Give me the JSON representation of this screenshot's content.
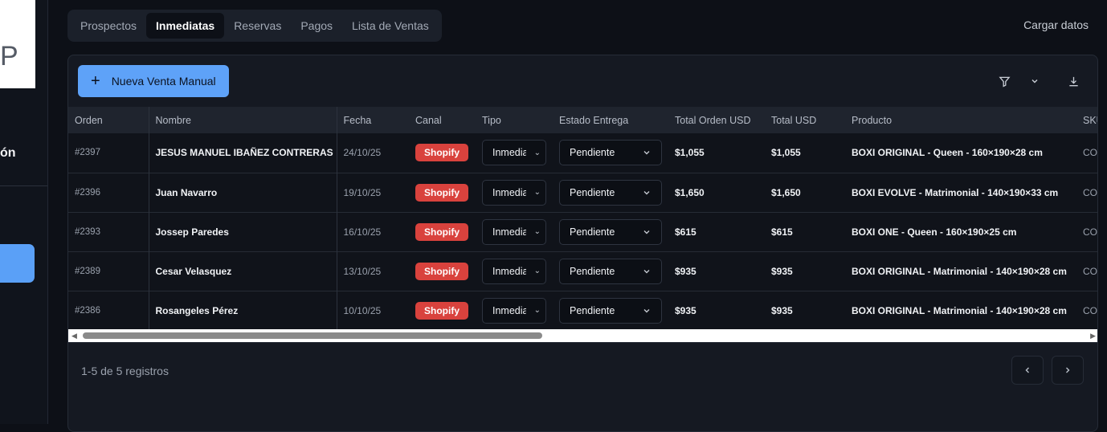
{
  "sidebar": {
    "logo_letter": "P",
    "section_label": "ón"
  },
  "tabs": [
    {
      "label": "Prospectos",
      "active": false
    },
    {
      "label": "Inmediatas",
      "active": true
    },
    {
      "label": "Reservas",
      "active": false
    },
    {
      "label": "Pagos",
      "active": false
    },
    {
      "label": "Lista de Ventas",
      "active": false
    }
  ],
  "header": {
    "load_data_label": "Cargar datos"
  },
  "toolbar": {
    "new_sale_label": "Nueva Venta Manual",
    "icons": [
      "filter-icon",
      "chevron-down-icon",
      "download-icon"
    ]
  },
  "table": {
    "columns": [
      "Orden",
      "Nombre",
      "Fecha",
      "Canal",
      "Tipo",
      "Estado Entrega",
      "Total Orden USD",
      "Total USD",
      "Producto",
      "SKU"
    ],
    "rows": [
      {
        "orden": "#2397",
        "nombre": "JESUS MANUEL IBAÑEZ CONTRERAS",
        "fecha": "24/10/25",
        "canal": "Shopify",
        "tipo": "Inmediata",
        "estado": "Pendiente",
        "total_orden": "$1,055",
        "total": "$1,055",
        "producto": "BOXI ORIGINAL - Queen - 160×190×28 cm",
        "sku": "CO"
      },
      {
        "orden": "#2396",
        "nombre": "Juan Navarro",
        "fecha": "19/10/25",
        "canal": "Shopify",
        "tipo": "Inmediata",
        "estado": "Pendiente",
        "total_orden": "$1,650",
        "total": "$1,650",
        "producto": "BOXI EVOLVE - Matrimonial - 140×190×33 cm",
        "sku": "CO"
      },
      {
        "orden": "#2393",
        "nombre": "Jossep Paredes",
        "fecha": "16/10/25",
        "canal": "Shopify",
        "tipo": "Inmediata",
        "estado": "Pendiente",
        "total_orden": "$615",
        "total": "$615",
        "producto": "BOXI ONE - Queen - 160×190×25 cm",
        "sku": "CO"
      },
      {
        "orden": "#2389",
        "nombre": "Cesar Velasquez",
        "fecha": "13/10/25",
        "canal": "Shopify",
        "tipo": "Inmediata",
        "estado": "Pendiente",
        "total_orden": "$935",
        "total": "$935",
        "producto": "BOXI ORIGINAL - Matrimonial - 140×190×28 cm",
        "sku": "CO"
      },
      {
        "orden": "#2386",
        "nombre": "Rosangeles Pérez",
        "fecha": "10/10/25",
        "canal": "Shopify",
        "tipo": "Inmediata",
        "estado": "Pendiente",
        "total_orden": "$935",
        "total": "$935",
        "producto": "BOXI ORIGINAL - Matrimonial - 140×190×28 cm",
        "sku": "CO"
      }
    ]
  },
  "footer": {
    "records_label": "1-5 de 5 registros"
  },
  "colors": {
    "accent": "#5ea2f8",
    "badge": "#d9423d",
    "background": "#0d1017"
  }
}
